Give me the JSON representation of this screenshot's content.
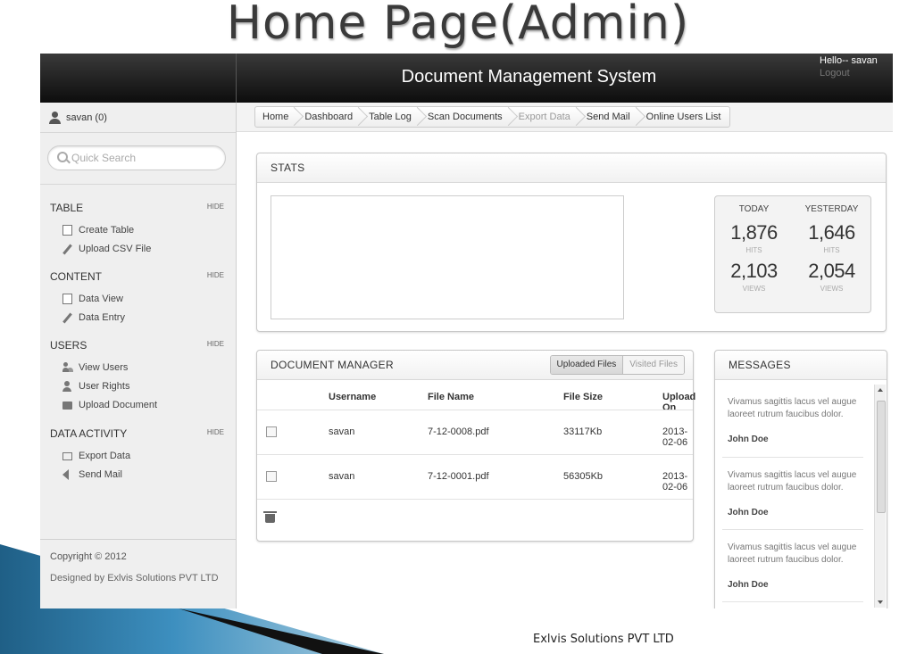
{
  "slide": {
    "title": "Home Page(Admin)",
    "footer_company": "Exlvis Solutions PVT LTD"
  },
  "header": {
    "title": "Document Management System",
    "hello": "Hello-- savan",
    "logout": "Logout"
  },
  "sidebar": {
    "user": "savan (0)",
    "search_placeholder": "Quick Search",
    "sections": [
      {
        "title": "TABLE",
        "hide": "HIDE",
        "items": [
          {
            "label": "Create Table",
            "icon": "new-document-icon"
          },
          {
            "label": "Upload CSV File",
            "icon": "pencil-icon"
          }
        ]
      },
      {
        "title": "CONTENT",
        "hide": "HIDE",
        "items": [
          {
            "label": "Data View",
            "icon": "new-document-icon"
          },
          {
            "label": "Data Entry",
            "icon": "pencil-icon"
          }
        ]
      },
      {
        "title": "USERS",
        "hide": "HIDE",
        "items": [
          {
            "label": "View Users",
            "icon": "users-icon"
          },
          {
            "label": "User Rights",
            "icon": "user-icon"
          },
          {
            "label": "Upload Document",
            "icon": "folder-icon"
          }
        ]
      },
      {
        "title": "DATA ACTIVITY",
        "hide": "HIDE",
        "items": [
          {
            "label": "Export Data",
            "icon": "box-icon"
          },
          {
            "label": "Send Mail",
            "icon": "speaker-icon"
          }
        ]
      }
    ],
    "copyright": "Copyright © 2012",
    "designed_by": "Designed by Exlvis Solutions PVT LTD"
  },
  "breadcrumb": [
    {
      "label": "Home",
      "disabled": false
    },
    {
      "label": "Dashboard",
      "disabled": false
    },
    {
      "label": "Table Log",
      "disabled": false
    },
    {
      "label": "Scan Documents",
      "disabled": false
    },
    {
      "label": "Export Data",
      "disabled": true
    },
    {
      "label": "Send Mail",
      "disabled": false
    },
    {
      "label": "Online Users List",
      "disabled": false
    }
  ],
  "stats": {
    "title": "STATS",
    "today": {
      "label": "TODAY",
      "hits": "1,876",
      "hits_label": "HITS",
      "views": "2,103",
      "views_label": "VIEWS"
    },
    "yesterday": {
      "label": "YESTERDAY",
      "hits": "1,646",
      "hits_label": "HITS",
      "views": "2,054",
      "views_label": "VIEWS"
    }
  },
  "documents": {
    "title": "DOCUMENT MANAGER",
    "tabs": [
      "Uploaded Files",
      "Visited Files"
    ],
    "columns": [
      "Username",
      "File Name",
      "File Size",
      "Upload On"
    ],
    "rows": [
      {
        "username": "savan",
        "file": "7-12-0008.pdf",
        "size": "33117Kb",
        "date": "2013-02-06"
      },
      {
        "username": "savan",
        "file": "7-12-0001.pdf",
        "size": "56305Kb",
        "date": "2013-02-06"
      }
    ]
  },
  "messages": {
    "title": "MESSAGES",
    "items": [
      {
        "text": "Vivamus sagittis lacus vel augue laoreet rutrum faucibus dolor.",
        "author": "John Doe"
      },
      {
        "text": "Vivamus sagittis lacus vel augue laoreet rutrum faucibus dolor.",
        "author": "John Doe"
      },
      {
        "text": "Vivamus sagittis lacus vel augue laoreet rutrum faucibus dolor.",
        "author": "John Doe"
      }
    ]
  }
}
